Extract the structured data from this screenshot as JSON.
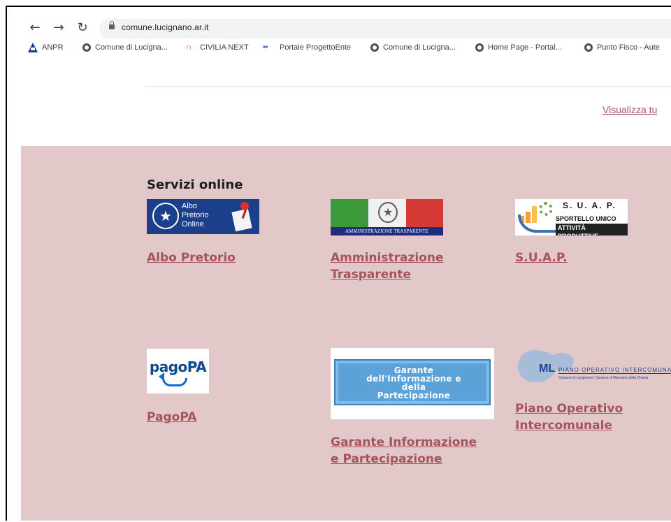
{
  "browser": {
    "url": "comune.lucignano.ar.it",
    "bookmarks": [
      {
        "label": "ANPR",
        "icon": "anpr-icon"
      },
      {
        "label": "Comune di Lucigna...",
        "icon": "globe-icon"
      },
      {
        "label": "CIVILIA NEXT",
        "icon": "civilia-icon"
      },
      {
        "label": "Portale ProgettoEnte",
        "icon": "progettoente-icon"
      },
      {
        "label": "Comune di Lucigna...",
        "icon": "globe-icon"
      },
      {
        "label": "Home Page - Portal...",
        "icon": "globe-icon"
      },
      {
        "label": "Punto Fisco - Aute",
        "icon": "globe-icon"
      }
    ]
  },
  "page": {
    "view_all_link": "Visualizza tu"
  },
  "services": {
    "title": "Servizi online",
    "items": [
      {
        "label": "Albo Pretorio",
        "logo_text": [
          "Albo",
          "Pretorio",
          "Online"
        ]
      },
      {
        "label_lines": [
          "Amministrazione",
          "Trasparente"
        ],
        "logo_text": "AMMINISTRAZIONE TRASPARENTE"
      },
      {
        "label": "S.U.A.P.",
        "logo_title": "S. U. A. P.",
        "logo_sub": [
          "SPORTELLO UNICO",
          "ATTIVITÀ PRODUTTIVE"
        ]
      },
      {
        "label": "PagoPA",
        "logo_text": "pagoPA"
      },
      {
        "label_lines": [
          "Garante Informazione",
          "e Partecipazione"
        ],
        "logo_text": [
          "Garante",
          "dell'Informazione e",
          "della",
          "Partecipazione"
        ]
      },
      {
        "label_lines": [
          "Piano Operativo",
          "Intercomunale"
        ],
        "logo_mark": "ML",
        "logo_title": "PIANO OPERATIVO INTERCOMUNALE",
        "logo_sub": "Comune di Lucignano I Comune di Marciano della Chiana"
      }
    ]
  },
  "colors": {
    "services_bg": "#e3c8c9",
    "link": "#a4545a"
  }
}
